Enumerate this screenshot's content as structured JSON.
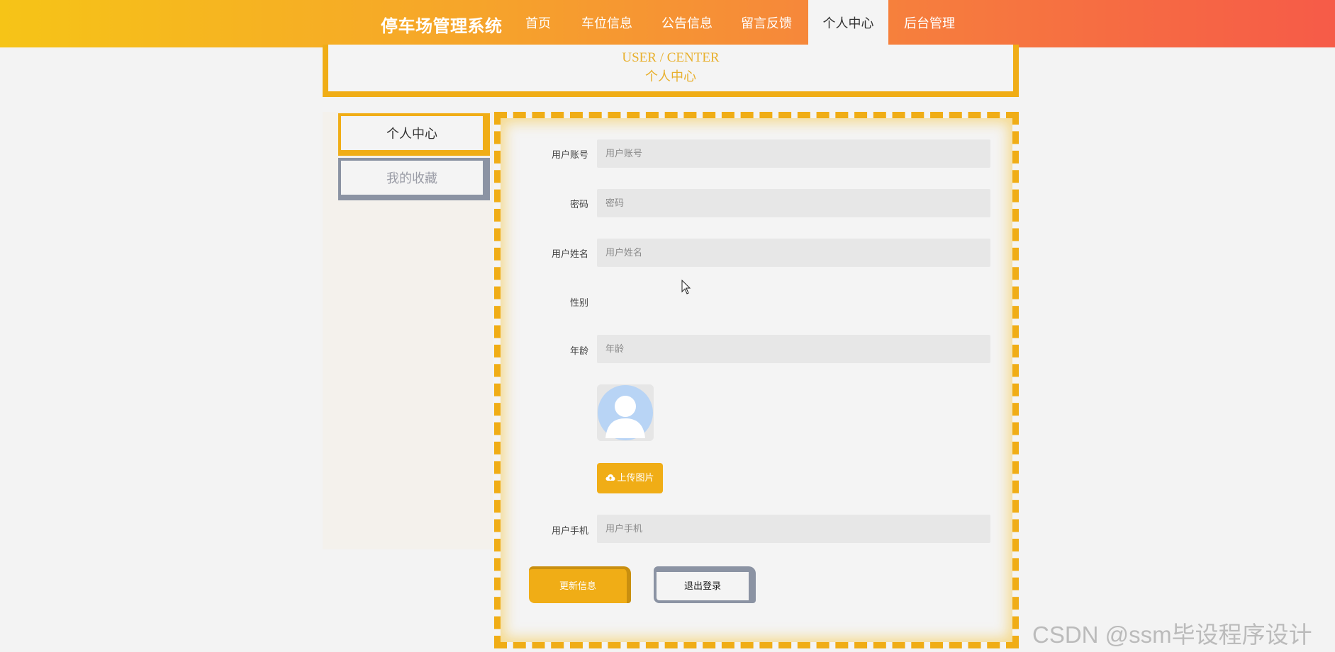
{
  "nav": {
    "brand": "停车场管理系统",
    "items": [
      {
        "label": "首页"
      },
      {
        "label": "车位信息"
      },
      {
        "label": "公告信息"
      },
      {
        "label": "留言反馈"
      },
      {
        "label": "个人中心",
        "active": true
      },
      {
        "label": "后台管理"
      }
    ]
  },
  "header": {
    "title_en": "USER / CENTER",
    "title_zh": "个人中心"
  },
  "sidebar": {
    "items": [
      {
        "label": "个人中心",
        "active": true
      },
      {
        "label": "我的收藏",
        "active": false
      }
    ]
  },
  "form": {
    "account": {
      "label": "用户账号",
      "placeholder": "用户账号",
      "value": ""
    },
    "password": {
      "label": "密码",
      "placeholder": "密码",
      "value": ""
    },
    "name": {
      "label": "用户姓名",
      "placeholder": "用户姓名",
      "value": ""
    },
    "gender": {
      "label": "性别",
      "value": ""
    },
    "age": {
      "label": "年龄",
      "placeholder": "年龄",
      "value": ""
    },
    "upload_label": "上传图片",
    "phone": {
      "label": "用户手机",
      "placeholder": "用户手机",
      "value": ""
    },
    "update_label": "更新信息",
    "logout_label": "退出登录"
  },
  "watermark": "CSDN @ssm毕设程序设计",
  "colors": {
    "accent": "#f0ad16",
    "nav_gradient_start": "#f6c417",
    "nav_gradient_end": "#f65b48",
    "secondary_border": "#8b93a3"
  },
  "icons": {
    "upload": "cloud-upload-icon",
    "avatar": "user-avatar-icon",
    "cursor": "mouse-cursor-icon"
  }
}
